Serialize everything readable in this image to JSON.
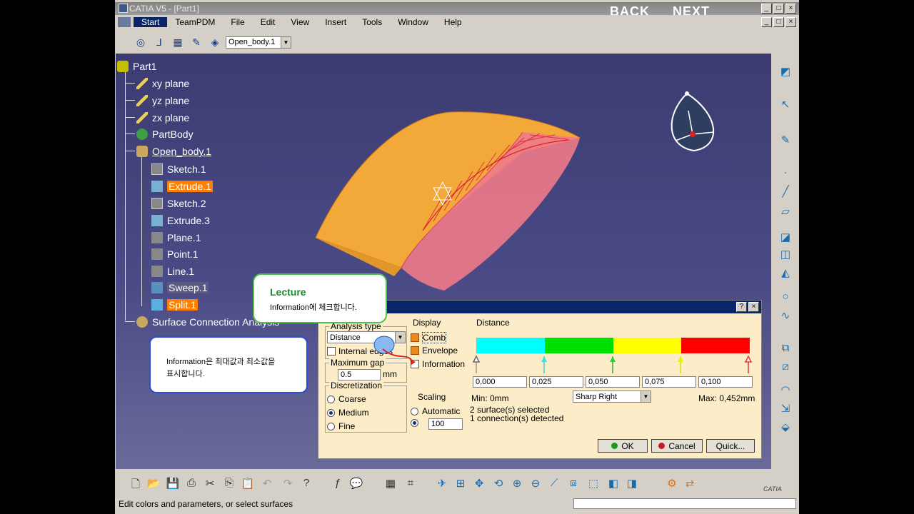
{
  "window": {
    "title": "CATIA V5 - [Part1]",
    "back_label": "BACK",
    "next_label": "NEXT"
  },
  "menubar": {
    "items": [
      "Start",
      "TeamPDM",
      "File",
      "Edit",
      "View",
      "Insert",
      "Tools",
      "Window",
      "Help"
    ]
  },
  "toolbar": {
    "body_combo": "Open_body.1"
  },
  "tree": {
    "root": "Part1",
    "items": [
      {
        "label": "xy plane"
      },
      {
        "label": "yz plane"
      },
      {
        "label": "zx plane"
      },
      {
        "label": "PartBody"
      },
      {
        "label": "Open_body.1"
      },
      {
        "label": "Sketch.1"
      },
      {
        "label": "Extrude.1"
      },
      {
        "label": "Sketch.2"
      },
      {
        "label": "Extrude.3"
      },
      {
        "label": "Plane.1"
      },
      {
        "label": "Point.1"
      },
      {
        "label": "Line.1"
      },
      {
        "label": "Sweep.1"
      },
      {
        "label": "Split.1"
      },
      {
        "label": "Surface Connection Analysis"
      }
    ]
  },
  "lecture": {
    "title": "Lecture",
    "text": "Information에 체크합니다."
  },
  "note": {
    "text_line1": "Information은 최대값과 최소값을",
    "text_line2": "표시합니다."
  },
  "dialog": {
    "analysis_type_label": "Analysis type",
    "analysis_type_value": "Distance",
    "internal_edges_label": "Internal edges",
    "maximum_gap_label": "Maximum gap",
    "maximum_gap_value": "0.5",
    "maximum_gap_unit": "mm",
    "discretization_label": "Discretization",
    "discretization_options": [
      "Coarse",
      "Medium",
      "Fine"
    ],
    "display_label": "Display",
    "display_options": [
      "Comb",
      "Envelope",
      "Information"
    ],
    "scaling_label": "Scaling",
    "scaling_auto": "Automatic",
    "scaling_value": "100",
    "distance_label": "Distance",
    "scale_values": [
      "0,000",
      "0,025",
      "0,050",
      "0,075",
      "0,100"
    ],
    "min_text": "Min: 0mm",
    "max_text": "Max: 0,452mm",
    "color_mode": "Sharp Right",
    "status_line1": "2 surface(s) selected",
    "status_line2": "1 connection(s) detected",
    "ok_label": "OK",
    "cancel_label": "Cancel",
    "quick_label": "Quick...",
    "colors": [
      "#00ffff",
      "#00e000",
      "#ffff00",
      "#ff0000"
    ]
  },
  "status": {
    "text": "Edit colors and parameters, or select surfaces"
  },
  "brand": {
    "logo_text": "CATIA"
  }
}
